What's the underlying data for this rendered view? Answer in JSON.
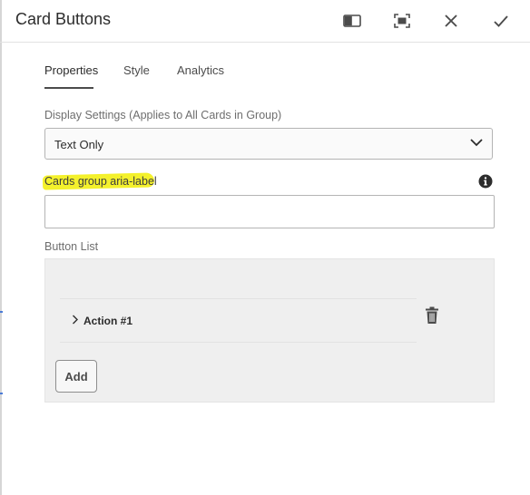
{
  "dialog": {
    "title": "Card Buttons",
    "header_icons": [
      "sidebar-toggle-icon",
      "fullscreen-icon",
      "close-icon",
      "checkmark-icon"
    ]
  },
  "tabs": [
    {
      "label": "Properties",
      "active": true
    },
    {
      "label": "Style",
      "active": false
    },
    {
      "label": "Analytics",
      "active": false
    }
  ],
  "display_settings": {
    "label": "Display Settings (Applies to All Cards in Group)",
    "selected": "Text Only"
  },
  "aria_label_field": {
    "label": "Cards group aria-label",
    "value": "",
    "placeholder": "",
    "highlight_color": "#f4f12c"
  },
  "button_list": {
    "label": "Button List",
    "items": [
      {
        "label": "Action #1"
      }
    ],
    "add_label": "Add"
  },
  "colors": {
    "accent_edge": "#4b7bd6",
    "panel_bg": "#efefef"
  }
}
